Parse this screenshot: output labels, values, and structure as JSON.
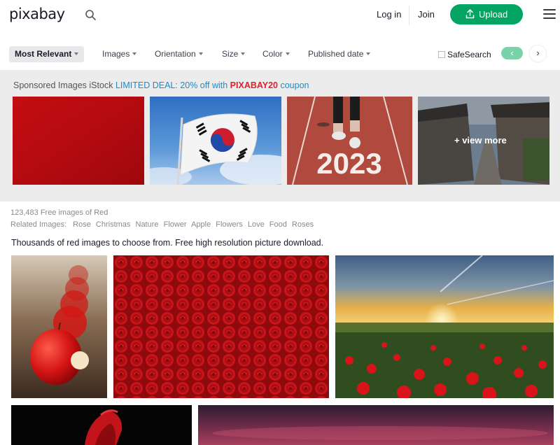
{
  "header": {
    "logo": "pixabay",
    "login_label": "Log in",
    "join_label": "Join",
    "upload_label": "Upload",
    "icons": [
      "search-icon",
      "upload-icon",
      "menu-icon"
    ]
  },
  "filters": {
    "sort": "Most Relevant",
    "items": [
      "Images",
      "Orientation",
      "Size",
      "Color",
      "Published date"
    ],
    "safesearch_label": "SafeSearch",
    "prev_glyph": "‹",
    "next_glyph": "›"
  },
  "sponsored": {
    "prefix": "Sponsored Images iStock",
    "deal": "LIMITED DEAL: 20% off with",
    "code": "PIXABAY20",
    "suffix": "coupon",
    "view_more": "+ view more",
    "year": "2023"
  },
  "results": {
    "count_text": "123,483 Free images of Red",
    "related_label": "Related Images:",
    "related": [
      "Rose",
      "Christmas",
      "Nature",
      "Flower",
      "Apple",
      "Flowers",
      "Love",
      "Food",
      "Roses"
    ],
    "description": "Thousands of red images to choose from. Free high resolution picture download."
  },
  "colors": {
    "brand_green": "#04a563",
    "link_blue": "#1a8bd0",
    "coupon_red": "#e0202a"
  }
}
